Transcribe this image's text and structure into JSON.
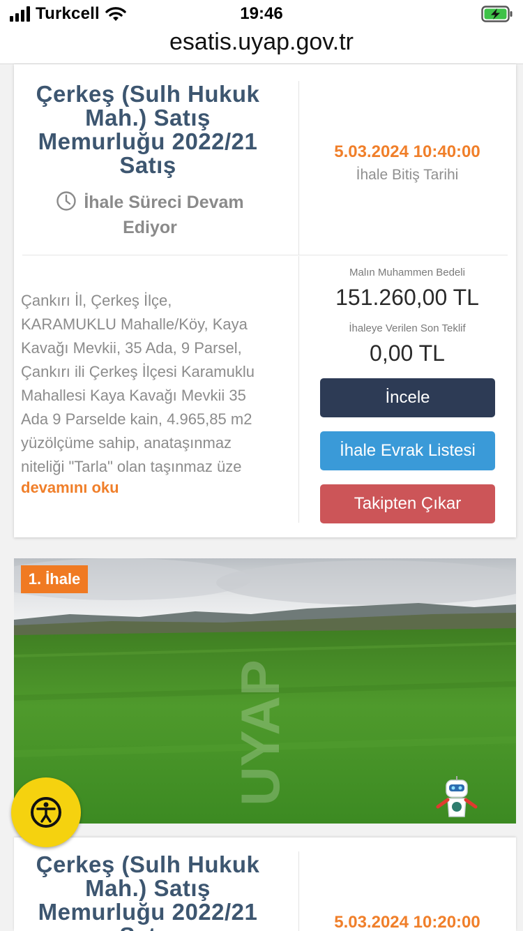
{
  "status_bar": {
    "carrier": "Turkcell",
    "time": "19:46"
  },
  "browser": {
    "url": "esatis.uyap.gov.tr"
  },
  "listing1": {
    "title_lines": [
      "Çerkeş (Sulh Hukuk",
      "Mah.) Satış",
      "Memurluğu 2022/21",
      "Satış"
    ],
    "status_lines": [
      "İhale Süreci Devam",
      "Ediyor"
    ],
    "end_date": "5.03.2024 10:40:00",
    "end_date_label": "İhale Bitiş Tarihi",
    "description_lines": [
      "Çankırı İl, Çerkeş İlçe,",
      "KARAMUKLU Mahalle/Köy, Kaya",
      "Kavağı Mevkii, 35 Ada, 9 Parsel,",
      "Çankırı ili Çerkeş İlçesi Karamuklu",
      "Mahallesi Kaya Kavağı Mevkii 35",
      "Ada 9 Parselde kain, 4.965,85 m2",
      "yüzölçüme sahip, anataşınmaz",
      "niteliği \"Tarla\" olan taşınmaz üze"
    ],
    "read_more": "devamını oku",
    "appraised_label": "Malın Muhammen Bedeli",
    "appraised_value": "151.260,00 TL",
    "last_bid_label": "İhaleye Verilen Son Teklif",
    "last_bid_value": "0,00 TL",
    "buttons": {
      "inspect": "İncele",
      "documents": "İhale Evrak Listesi",
      "unfollow": "Takipten Çıkar"
    }
  },
  "listing2": {
    "badge": "1. İhale",
    "watermark": "UYAP",
    "title_lines": [
      "Çerkeş (Sulh Hukuk",
      "Mah.) Satış",
      "Memurluğu 2022/21",
      "Satış"
    ],
    "end_date": "5.03.2024 10:20:00"
  },
  "colors": {
    "title": "#3d5670",
    "accent_orange": "#f07f2a",
    "btn_dark": "#2d3b55",
    "btn_blue": "#3a9ad8",
    "btn_red": "#cc5558",
    "a11y_yellow": "#f5d20f"
  },
  "icons": [
    "signal-icon",
    "wifi-icon",
    "battery-charging-icon",
    "clock-icon",
    "accessibility-icon",
    "robot-assistant-icon"
  ]
}
